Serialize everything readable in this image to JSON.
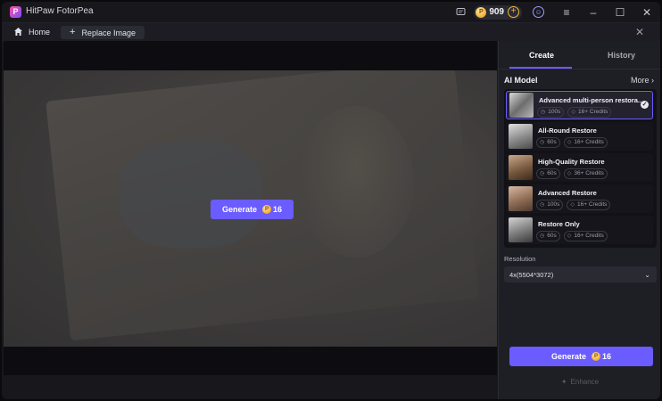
{
  "app": {
    "title": "HitPaw FotorPea",
    "logo_letter": "P"
  },
  "titlebar": {
    "credits": "909"
  },
  "toolbar": {
    "home_label": "Home",
    "replace_label": "Replace Image"
  },
  "canvas": {
    "generate_label": "Generate",
    "generate_cost": "16"
  },
  "panel": {
    "tabs": [
      {
        "label": "Create",
        "active": true
      },
      {
        "label": "History",
        "active": false
      }
    ],
    "ai_model_heading": "AI Model",
    "more_label": "More",
    "models": [
      {
        "name": "Advanced multi-person restora...",
        "time": "100s",
        "credits": "16+ Credits",
        "selected": true
      },
      {
        "name": "All-Round Restore",
        "time": "60s",
        "credits": "16+ Credits",
        "selected": false
      },
      {
        "name": "High-Quality Restore",
        "time": "60s",
        "credits": "36+ Credits",
        "selected": false
      },
      {
        "name": "Advanced Restore",
        "time": "100s",
        "credits": "16+ Credits",
        "selected": false
      },
      {
        "name": "Restore Only",
        "time": "60s",
        "credits": "16+ Credits",
        "selected": false
      }
    ],
    "resolution_label": "Resolution",
    "resolution_value": "4x(5504*3072)",
    "generate_label": "Generate",
    "generate_cost": "16",
    "enhance_label": "Enhance"
  },
  "colors": {
    "accent": "#6a5cff",
    "coin": "#f4b43a"
  }
}
